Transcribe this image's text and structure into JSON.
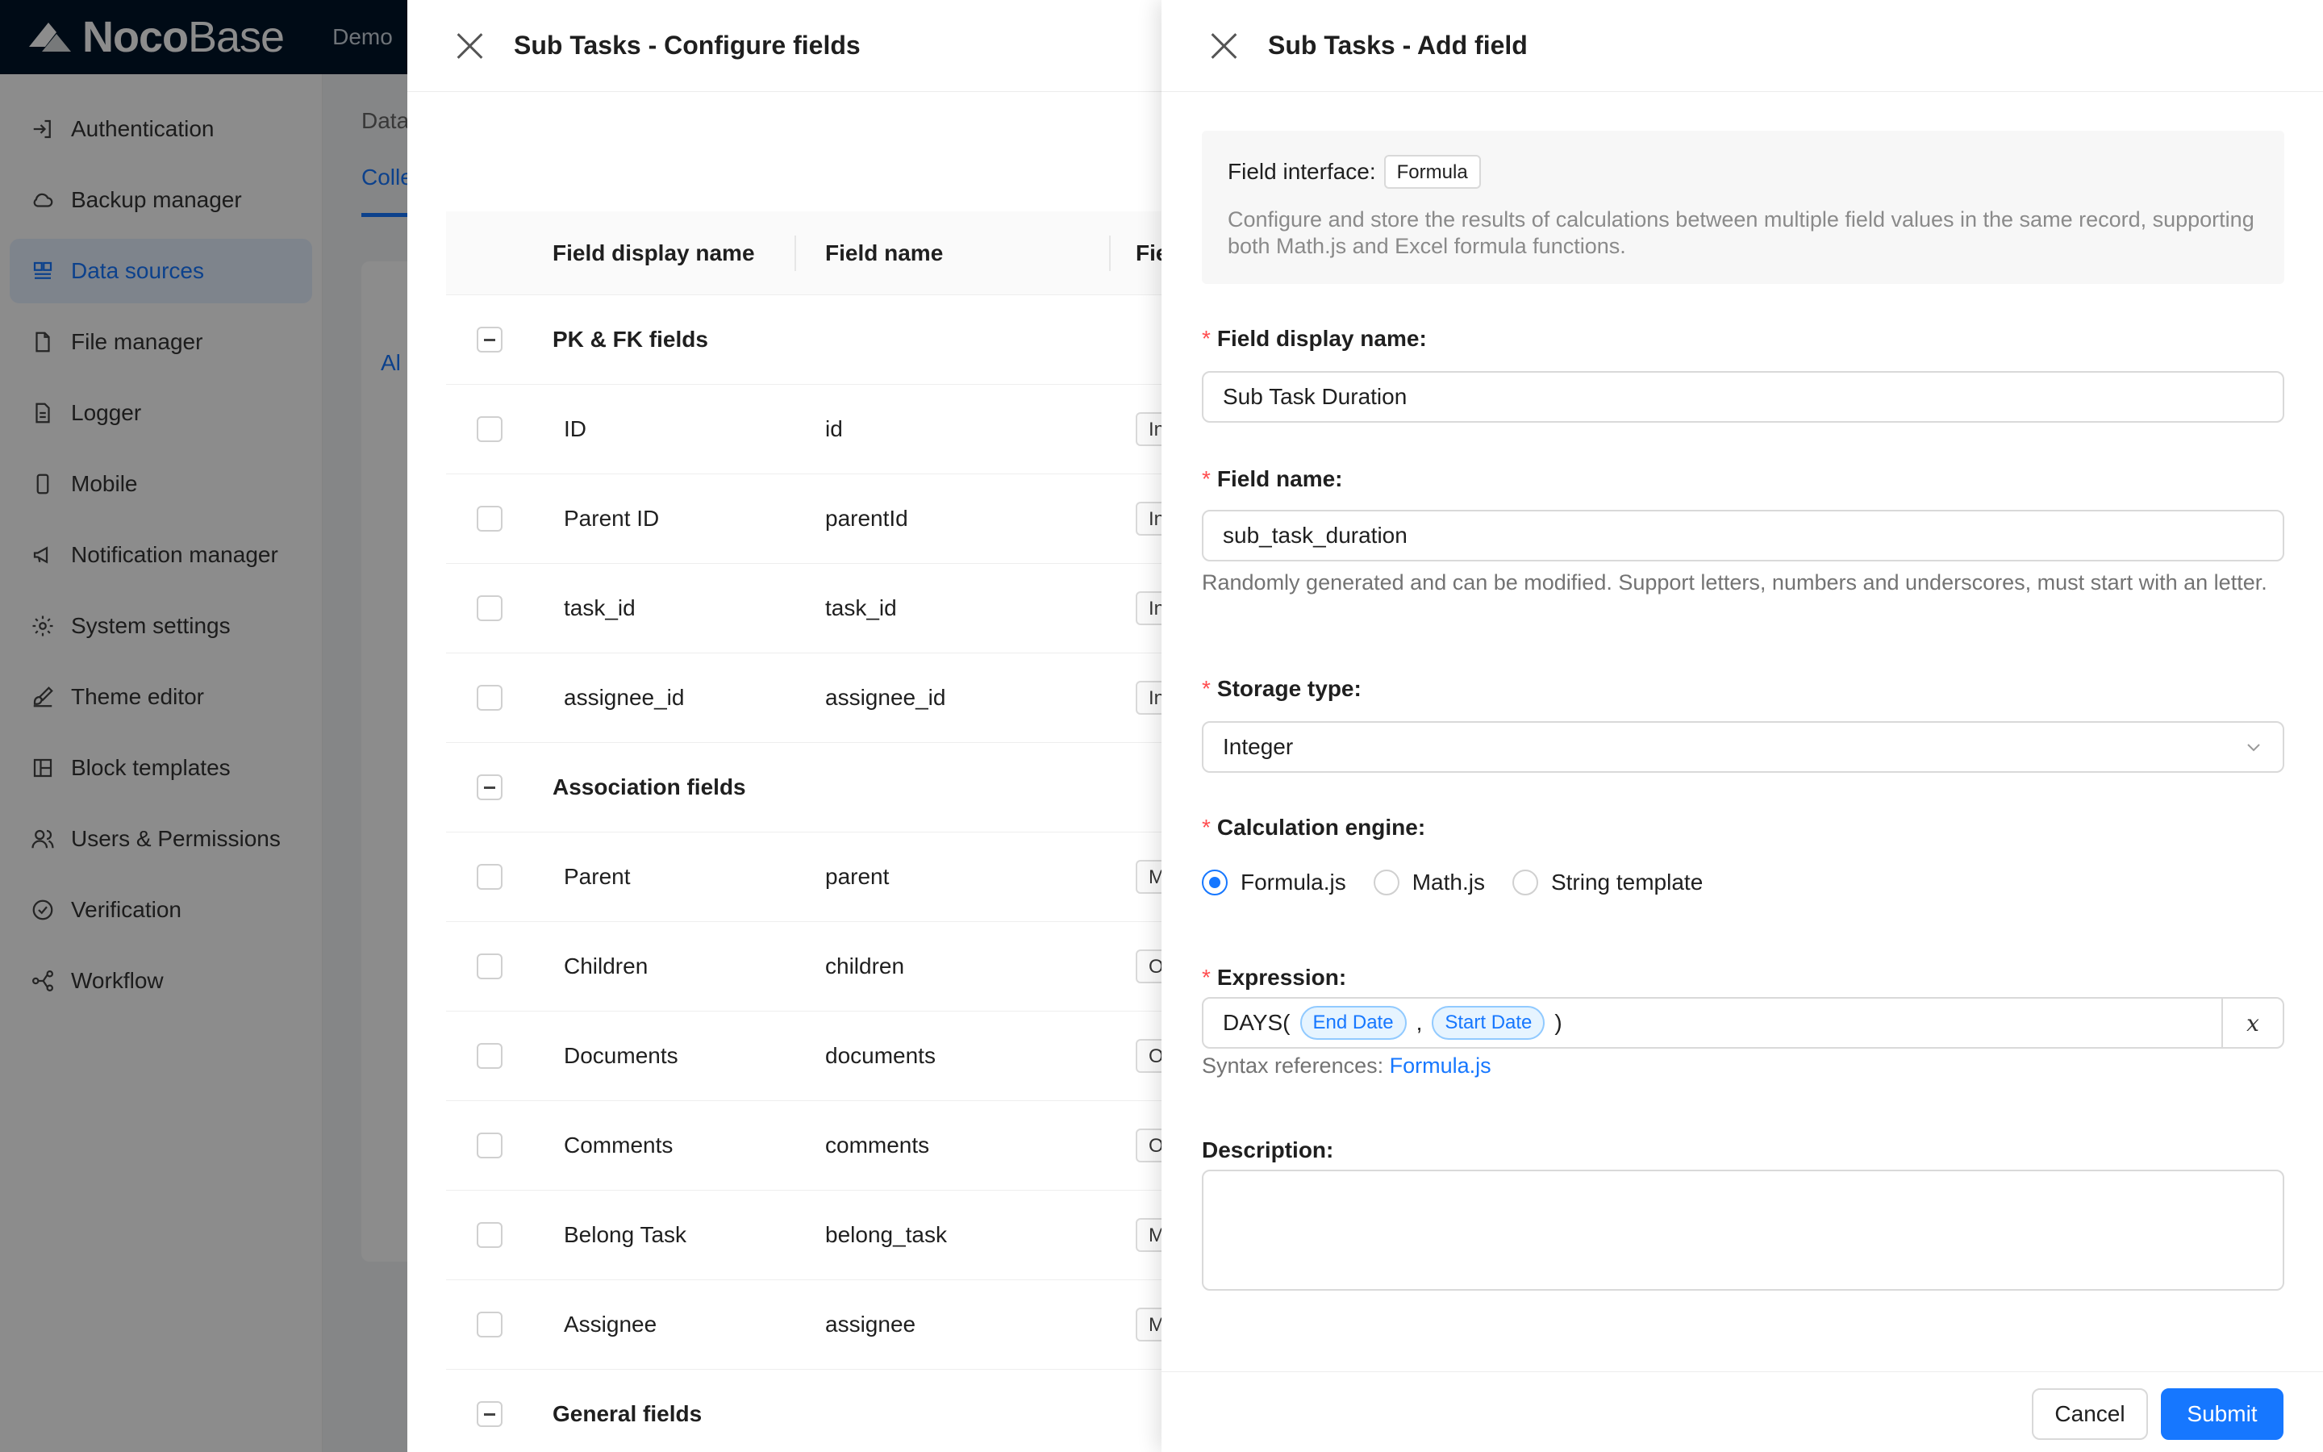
{
  "app": {
    "brand_bold": "Noco",
    "brand_light": "Base",
    "top_partial": "Demo",
    "breadcrumb_partial": "Data",
    "tab_partial": "Colle",
    "card_partial": "Al"
  },
  "sidebar": {
    "items": [
      {
        "label": "Authentication",
        "icon": "login-icon"
      },
      {
        "label": "Backup manager",
        "icon": "cloud-icon"
      },
      {
        "label": "Data sources",
        "icon": "database-icon",
        "active": true
      },
      {
        "label": "File manager",
        "icon": "file-icon"
      },
      {
        "label": "Logger",
        "icon": "log-file-icon"
      },
      {
        "label": "Mobile",
        "icon": "mobile-icon"
      },
      {
        "label": "Notification manager",
        "icon": "megaphone-icon"
      },
      {
        "label": "System settings",
        "icon": "gear-icon"
      },
      {
        "label": "Theme editor",
        "icon": "brush-icon"
      },
      {
        "label": "Block templates",
        "icon": "layout-icon"
      },
      {
        "label": "Users & Permissions",
        "icon": "users-icon"
      },
      {
        "label": "Verification",
        "icon": "check-circle-icon"
      },
      {
        "label": "Workflow",
        "icon": "workflow-icon"
      }
    ]
  },
  "configure": {
    "title": "Sub Tasks - Configure fields",
    "columns": [
      "Field display name",
      "Field name",
      "Field i"
    ],
    "groups": [
      {
        "label": "PK & FK fields",
        "rows": [
          {
            "display": "ID",
            "name": "id",
            "type": "Intege"
          },
          {
            "display": "Parent ID",
            "name": "parentId",
            "type": "Intege"
          },
          {
            "display": "task_id",
            "name": "task_id",
            "type": "Intege"
          },
          {
            "display": "assignee_id",
            "name": "assignee_id",
            "type": "Intege"
          }
        ]
      },
      {
        "label": "Association fields",
        "rows": [
          {
            "display": "Parent",
            "name": "parent",
            "type": "Many"
          },
          {
            "display": "Children",
            "name": "children",
            "type": "One to"
          },
          {
            "display": "Documents",
            "name": "documents",
            "type": "One to"
          },
          {
            "display": "Comments",
            "name": "comments",
            "type": "One to"
          },
          {
            "display": "Belong Task",
            "name": "belong_task",
            "type": "Many"
          },
          {
            "display": "Assignee",
            "name": "assignee",
            "type": "Many"
          }
        ]
      },
      {
        "label": "General fields",
        "rows": []
      }
    ]
  },
  "add_field": {
    "title": "Sub Tasks - Add field",
    "interface_label": "Field interface:",
    "interface_value": "Formula",
    "interface_desc": "Configure and store the results of calculations between multiple field values in the same record, supporting both Math.js and Excel formula functions.",
    "display_name_label": "Field display name",
    "display_name_value": "Sub Task Duration",
    "field_name_label": "Field name",
    "field_name_value": "sub_task_duration",
    "field_name_help": "Randomly generated and can be modified. Support letters, numbers and underscores, must start with an letter.",
    "storage_label": "Storage type",
    "storage_value": "Integer",
    "engine_label": "Calculation engine",
    "engine_options": [
      "Formula.js",
      "Math.js",
      "String template"
    ],
    "engine_selected": "Formula.js",
    "expression_label": "Expression",
    "expression_prefix": "DAYS(",
    "expression_chip1": "End Date",
    "expression_sep": ",",
    "expression_chip2": "Start Date",
    "expression_suffix": ")",
    "expression_var_button": "x",
    "syntax_label": "Syntax references:",
    "syntax_link": "Formula.js",
    "description_label": "Description",
    "colon": ":",
    "required_mark": "*",
    "cancel_label": "Cancel",
    "submit_label": "Submit"
  },
  "colors": {
    "accent": "#1677ff",
    "topbar": "#001529",
    "required": "#ff4d4f"
  }
}
